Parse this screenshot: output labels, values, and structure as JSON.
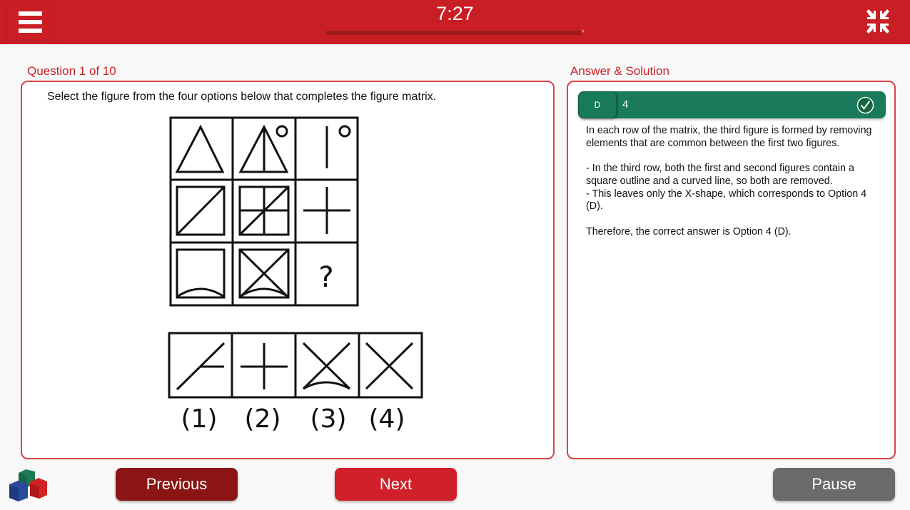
{
  "header": {
    "timer": "7:27",
    "progress_percent": 100,
    "progress_end_mark": "›"
  },
  "question": {
    "label": "Question 1 of 10",
    "text": "Select the figure from the four options below that completes the figure matrix.",
    "missing_mark": "?",
    "option_labels": [
      "(1)",
      "(2)",
      "(3)",
      "(4)"
    ]
  },
  "answer": {
    "label": "Answer & Solution",
    "letter": "D",
    "value": "4",
    "solution": [
      "In each row of the matrix, the third figure is formed by removing elements that are common between the first two figures.",
      "- In the third row, both the first and second figures contain a square outline and a curved line, so both are removed.",
      "- This leaves only the X-shape, which corresponds to Option 4 (D).",
      "Therefore, the correct answer is Option 4 (D)."
    ]
  },
  "footer": {
    "previous": "Previous",
    "next": "Next",
    "pause": "Pause"
  },
  "colors": {
    "brand": "#c91f24",
    "correct": "#1a7a5c",
    "previous": "#8b1414",
    "pause": "#6b6b6b"
  }
}
